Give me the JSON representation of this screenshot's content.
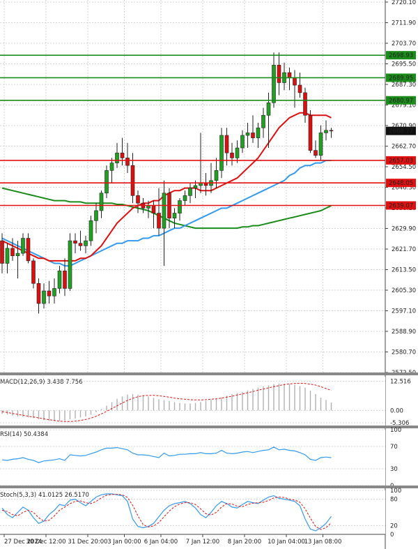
{
  "chart_data": {
    "type": "candlestick",
    "main": {
      "y_ticks": [
        2720.1,
        2711.9,
        2703.7,
        2695.5,
        2687.3,
        2679.1,
        2670.9,
        2662.7,
        2654.5,
        2646.3,
        2638.1,
        2629.9,
        2621.7,
        2613.5,
        2605.3,
        2597.1,
        2588.9,
        2580.7,
        2572.5
      ],
      "ylim": [
        2572.5,
        2720.1
      ],
      "last_price": 2668.77,
      "horizontal_levels": [
        {
          "value": 2698.93,
          "color": "#1a8c1a"
        },
        {
          "value": 2689.95,
          "color": "#1a8c1a"
        },
        {
          "value": 2680.97,
          "color": "#1a8c1a"
        },
        {
          "value": 2657.03,
          "color": "#e01010"
        },
        {
          "value": 2648.05,
          "color": "#e01010"
        },
        {
          "value": 2639.07,
          "color": "#e01010"
        }
      ],
      "candles": [
        [
          2625,
          2628,
          2612,
          2616
        ],
        [
          2616,
          2624,
          2612,
          2622
        ],
        [
          2622,
          2626,
          2617,
          2619
        ],
        [
          2619,
          2625,
          2610,
          2620
        ],
        [
          2620,
          2628,
          2619,
          2626
        ],
        [
          2626,
          2628,
          2616,
          2617
        ],
        [
          2617,
          2618,
          2606,
          2608
        ],
        [
          2608,
          2610,
          2596,
          2600
        ],
        [
          2600,
          2608,
          2598,
          2605
        ],
        [
          2605,
          2609,
          2600,
          2603
        ],
        [
          2603,
          2610,
          2600,
          2606
        ],
        [
          2606,
          2615,
          2604,
          2613
        ],
        [
          2613,
          2618,
          2603,
          2606
        ],
        [
          2606,
          2628,
          2605,
          2625
        ],
        [
          2625,
          2628,
          2620,
          2624
        ],
        [
          2624,
          2629,
          2621,
          2623
        ],
        [
          2623,
          2627,
          2620,
          2625
        ],
        [
          2625,
          2635,
          2623,
          2633
        ],
        [
          2633,
          2640,
          2628,
          2637
        ],
        [
          2637,
          2645,
          2634,
          2644
        ],
        [
          2644,
          2655,
          2642,
          2653
        ],
        [
          2653,
          2658,
          2648,
          2656
        ],
        [
          2656,
          2664,
          2654,
          2660
        ],
        [
          2660,
          2666,
          2655,
          2658
        ],
        [
          2658,
          2664,
          2652,
          2655
        ],
        [
          2655,
          2660,
          2640,
          2643
        ],
        [
          2643,
          2645,
          2636,
          2640
        ],
        [
          2640,
          2642,
          2636,
          2638
        ],
        [
          2638,
          2641,
          2634,
          2639
        ],
        [
          2639,
          2641,
          2630,
          2636
        ],
        [
          2636,
          2646,
          2627,
          2630
        ],
        [
          2630,
          2649,
          2615,
          2644
        ],
        [
          2644,
          2646,
          2630,
          2634
        ],
        [
          2634,
          2638,
          2630,
          2636
        ],
        [
          2636,
          2642,
          2633,
          2641
        ],
        [
          2641,
          2645,
          2639,
          2643
        ],
        [
          2643,
          2648,
          2640,
          2646
        ],
        [
          2646,
          2649,
          2642,
          2647
        ],
        [
          2647,
          2668,
          2644,
          2648
        ],
        [
          2648,
          2652,
          2643,
          2647
        ],
        [
          2647,
          2656,
          2644,
          2649
        ],
        [
          2649,
          2658,
          2646,
          2653
        ],
        [
          2653,
          2670,
          2650,
          2667
        ],
        [
          2667,
          2670,
          2655,
          2660
        ],
        [
          2660,
          2664,
          2655,
          2658
        ],
        [
          2658,
          2665,
          2656,
          2662
        ],
        [
          2662,
          2669,
          2660,
          2667
        ],
        [
          2667,
          2672,
          2662,
          2668
        ],
        [
          2668,
          2675,
          2664,
          2666
        ],
        [
          2666,
          2672,
          2662,
          2670
        ],
        [
          2670,
          2678,
          2666,
          2675
        ],
        [
          2675,
          2684,
          2662,
          2680
        ],
        [
          2680,
          2700,
          2678,
          2695
        ],
        [
          2695,
          2700,
          2683,
          2688
        ],
        [
          2688,
          2696,
          2685,
          2692
        ],
        [
          2692,
          2694,
          2685,
          2690
        ],
        [
          2690,
          2693,
          2678,
          2687
        ],
        [
          2687,
          2692,
          2682,
          2684
        ],
        [
          2684,
          2686,
          2672,
          2675
        ],
        [
          2675,
          2677,
          2660,
          2661
        ],
        [
          2661,
          2665,
          2658,
          2659
        ],
        [
          2659,
          2671,
          2657,
          2668
        ],
        [
          2668,
          2673,
          2665,
          2669
        ],
        [
          2669,
          2670,
          2666,
          2668.77
        ]
      ],
      "ma_red": [
        2625,
        2624,
        2623,
        2622,
        2621,
        2620,
        2619,
        2618,
        2618,
        2617,
        2617,
        2617,
        2617,
        2617,
        2617,
        2618,
        2618,
        2619,
        2621,
        2623,
        2626,
        2629,
        2632,
        2634,
        2636,
        2638,
        2639,
        2640,
        2640,
        2641,
        2641,
        2643,
        2644,
        2645,
        2645,
        2646,
        2646,
        2646,
        2645,
        2645,
        2645,
        2646,
        2647,
        2648,
        2649,
        2650,
        2652,
        2654,
        2656,
        2658,
        2661,
        2664,
        2667,
        2670,
        2672,
        2674,
        2675,
        2676,
        2676,
        2675,
        2675,
        2675,
        2675,
        2674
      ],
      "ma_blue": [
        2626,
        2625,
        2624,
        2623,
        2622,
        2621,
        2620,
        2619,
        2618,
        2617,
        2616,
        2616,
        2615,
        2615,
        2616,
        2617,
        2618,
        2619,
        2620,
        2621,
        2622,
        2623,
        2624,
        2624,
        2625,
        2625,
        2625,
        2626,
        2626,
        2627,
        2627,
        2628,
        2629,
        2630,
        2630,
        2631,
        2632,
        2633,
        2634,
        2635,
        2636,
        2637,
        2638,
        2638,
        2639,
        2640,
        2641,
        2642,
        2643,
        2644,
        2645,
        2646,
        2647,
        2648,
        2649,
        2651,
        2652,
        2654,
        2655,
        2655,
        2656,
        2656,
        2657,
        2657
      ],
      "ma_green": [
        2646,
        2645.5,
        2645,
        2644.5,
        2644,
        2643.5,
        2643,
        2642.5,
        2642,
        2641.5,
        2641,
        2641,
        2641,
        2640.5,
        2640.5,
        2640.5,
        2640,
        2640,
        2640,
        2640,
        2640,
        2640,
        2639.5,
        2639.5,
        2639,
        2638.5,
        2638,
        2637.5,
        2637,
        2636,
        2635,
        2634,
        2633,
        2632,
        2631.5,
        2631,
        2630.5,
        2630,
        2630,
        2630,
        2630,
        2630,
        2630,
        2630,
        2630,
        2630,
        2630.5,
        2630.5,
        2631,
        2631,
        2631.5,
        2632,
        2632.5,
        2633,
        2633.5,
        2634,
        2634.5,
        2635,
        2635.5,
        2636,
        2636.5,
        2637,
        2638,
        2639
      ]
    },
    "x_labels": [
      {
        "label": "27 Dec 2024",
        "index": 0
      },
      {
        "label": "30 Dec 12:00",
        "index": 8
      },
      {
        "label": "31 Dec 20:00",
        "index": 16
      },
      {
        "label": "3 Jan 00:00",
        "index": 23
      },
      {
        "label": "6 Jan 04:00",
        "index": 30
      },
      {
        "label": "7 Jan 12:00",
        "index": 38
      },
      {
        "label": "8 Jan 20:00",
        "index": 46
      },
      {
        "label": "10 Jan 04:00",
        "index": 54
      },
      {
        "label": "13 Jan 08:00",
        "index": 61
      }
    ],
    "macd": {
      "label": "MACD(12,26,9) 3.438 7.756",
      "y_ticks": [
        12.516,
        0.0,
        -5.306
      ],
      "ylim": [
        -6.5,
        14.5
      ],
      "histogram": [
        -1.5,
        -1.8,
        -2.2,
        -2.6,
        -2.8,
        -3.0,
        -3.3,
        -3.8,
        -4.2,
        -4.5,
        -4.6,
        -4.5,
        -4.4,
        -3.8,
        -3.5,
        -3.0,
        -2.6,
        -1.8,
        -0.8,
        0.5,
        2,
        3.5,
        5,
        6,
        6.8,
        7,
        6.8,
        6.4,
        6,
        5.4,
        4.8,
        4.4,
        4,
        3.6,
        3.2,
        3,
        3,
        3.2,
        3.6,
        4,
        4.5,
        5,
        5.6,
        6.3,
        7,
        7.5,
        8,
        8.6,
        9.2,
        9.8,
        10.3,
        10.8,
        11.3,
        11.5,
        11.5,
        11.3,
        11,
        10.5,
        9.8,
        8.5,
        7,
        5.5,
        4.5,
        3.4
      ],
      "signal": [
        -0.5,
        -0.9,
        -1.3,
        -1.7,
        -2.1,
        -2.5,
        -2.8,
        -3.2,
        -3.6,
        -4,
        -4.3,
        -4.6,
        -4.8,
        -4.8,
        -4.6,
        -4.3,
        -3.9,
        -3.3,
        -2.5,
        -1.5,
        -0.4,
        0.8,
        2,
        3.2,
        4.3,
        5.2,
        5.9,
        6.3,
        6.5,
        6.5,
        6.3,
        6,
        5.7,
        5.3,
        5,
        4.8,
        4.6,
        4.5,
        4.5,
        4.6,
        4.8,
        5,
        5.3,
        5.7,
        6.1,
        6.6,
        7.1,
        7.6,
        8.1,
        8.7,
        9.2,
        9.7,
        10.2,
        10.7,
        11.1,
        11.4,
        11.6,
        11.7,
        11.6,
        11.3,
        10.9,
        10.2,
        9.4,
        8.6
      ]
    },
    "rsi": {
      "label": "RSI(14) 50.4384",
      "y_ticks": [
        100,
        70,
        30,
        0
      ],
      "values": [
        46,
        45,
        47,
        48,
        50,
        47,
        45,
        41,
        44,
        45,
        46,
        48,
        45,
        55,
        54,
        53,
        54,
        57,
        60,
        64,
        67,
        67,
        68,
        66,
        64,
        58,
        55,
        55,
        54,
        52,
        50,
        58,
        53,
        54,
        56,
        56,
        57,
        57,
        59,
        57,
        57,
        58,
        63,
        58,
        57,
        58,
        60,
        61,
        59,
        61,
        63,
        64,
        69,
        64,
        65,
        63,
        62,
        59,
        55,
        47,
        45,
        50,
        51,
        50
      ]
    },
    "stoch": {
      "label": "Stoch(5,3,3) 41.0125 26.5170",
      "y_ticks": [
        100,
        80,
        20,
        0
      ],
      "k": [
        60,
        45,
        38,
        50,
        62,
        55,
        38,
        25,
        30,
        45,
        55,
        68,
        65,
        78,
        80,
        72,
        65,
        75,
        85,
        90,
        92,
        92,
        90,
        88,
        75,
        35,
        18,
        15,
        18,
        25,
        40,
        55,
        65,
        70,
        72,
        75,
        70,
        60,
        45,
        38,
        50,
        65,
        75,
        70,
        62,
        60,
        68,
        75,
        72,
        70,
        78,
        85,
        88,
        82,
        80,
        78,
        75,
        65,
        35,
        12,
        8,
        15,
        25,
        41
      ],
      "d": [
        55,
        52,
        45,
        42,
        50,
        55,
        50,
        38,
        30,
        32,
        42,
        55,
        62,
        70,
        75,
        76,
        72,
        70,
        75,
        83,
        89,
        91,
        91,
        90,
        84,
        66,
        42,
        22,
        17,
        19,
        27,
        40,
        53,
        63,
        69,
        72,
        72,
        68,
        58,
        47,
        44,
        50,
        62,
        70,
        69,
        64,
        63,
        68,
        71,
        72,
        73,
        77,
        83,
        85,
        84,
        80,
        78,
        73,
        58,
        37,
        18,
        11,
        15,
        26.5
      ]
    }
  }
}
